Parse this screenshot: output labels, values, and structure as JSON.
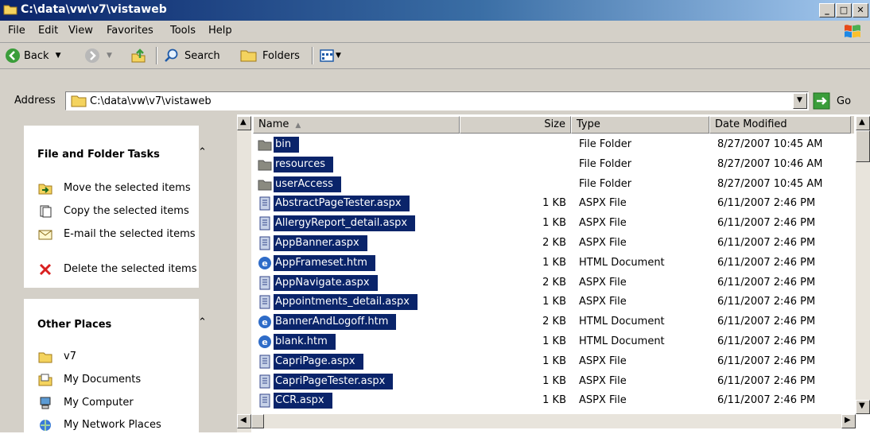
{
  "window": {
    "title": "C:\\data\\vw\\v7\\vistaweb"
  },
  "menu": [
    "File",
    "Edit",
    "View",
    "Favorites",
    "Tools",
    "Help"
  ],
  "toolbar": {
    "back": "Back",
    "search": "Search",
    "folders": "Folders"
  },
  "address": {
    "label": "Address",
    "value": "C:\\data\\vw\\v7\\vistaweb",
    "go": "Go"
  },
  "tasks": {
    "title": "File and Folder Tasks",
    "items": [
      {
        "label": "Move the selected items",
        "icon": "move-icon"
      },
      {
        "label": "Copy the selected items",
        "icon": "copy-icon"
      },
      {
        "label": "E-mail the selected items",
        "icon": "email-icon"
      },
      {
        "label": "Delete the selected items",
        "icon": "delete-icon"
      }
    ]
  },
  "places": {
    "title": "Other Places",
    "items": [
      {
        "label": "v7",
        "icon": "folder-icon"
      },
      {
        "label": "My Documents",
        "icon": "my-documents-icon"
      },
      {
        "label": "My Computer",
        "icon": "my-computer-icon"
      },
      {
        "label": "My Network Places",
        "icon": "network-places-icon"
      }
    ]
  },
  "columns": {
    "name": "Name",
    "size": "Size",
    "type": "Type",
    "date": "Date Modified"
  },
  "files": [
    {
      "name": "bin",
      "size": "",
      "type": "File Folder",
      "date": "8/27/2007 10:45 AM",
      "kind": "folder"
    },
    {
      "name": "resources",
      "size": "",
      "type": "File Folder",
      "date": "8/27/2007 10:46 AM",
      "kind": "folder"
    },
    {
      "name": "userAccess",
      "size": "",
      "type": "File Folder",
      "date": "8/27/2007 10:45 AM",
      "kind": "folder"
    },
    {
      "name": "AbstractPageTester.aspx",
      "size": "1 KB",
      "type": "ASPX File",
      "date": "6/11/2007 2:46 PM",
      "kind": "aspx"
    },
    {
      "name": "AllergyReport_detail.aspx",
      "size": "1 KB",
      "type": "ASPX File",
      "date": "6/11/2007 2:46 PM",
      "kind": "aspx"
    },
    {
      "name": "AppBanner.aspx",
      "size": "2 KB",
      "type": "ASPX File",
      "date": "6/11/2007 2:46 PM",
      "kind": "aspx"
    },
    {
      "name": "AppFrameset.htm",
      "size": "1 KB",
      "type": "HTML Document",
      "date": "6/11/2007 2:46 PM",
      "kind": "htm"
    },
    {
      "name": "AppNavigate.aspx",
      "size": "2 KB",
      "type": "ASPX File",
      "date": "6/11/2007 2:46 PM",
      "kind": "aspx"
    },
    {
      "name": "Appointments_detail.aspx",
      "size": "1 KB",
      "type": "ASPX File",
      "date": "6/11/2007 2:46 PM",
      "kind": "aspx"
    },
    {
      "name": "BannerAndLogoff.htm",
      "size": "2 KB",
      "type": "HTML Document",
      "date": "6/11/2007 2:46 PM",
      "kind": "htm"
    },
    {
      "name": "blank.htm",
      "size": "1 KB",
      "type": "HTML Document",
      "date": "6/11/2007 2:46 PM",
      "kind": "htm"
    },
    {
      "name": "CapriPage.aspx",
      "size": "1 KB",
      "type": "ASPX File",
      "date": "6/11/2007 2:46 PM",
      "kind": "aspx"
    },
    {
      "name": "CapriPageTester.aspx",
      "size": "1 KB",
      "type": "ASPX File",
      "date": "6/11/2007 2:46 PM",
      "kind": "aspx"
    },
    {
      "name": "CCR.aspx",
      "size": "1 KB",
      "type": "ASPX File",
      "date": "6/11/2007 2:46 PM",
      "kind": "aspx"
    }
  ],
  "colors": {
    "selection": "#0a246a",
    "chrome": "#d4d0c8",
    "titlebar_start": "#0a246a",
    "titlebar_end": "#a6caf0"
  }
}
